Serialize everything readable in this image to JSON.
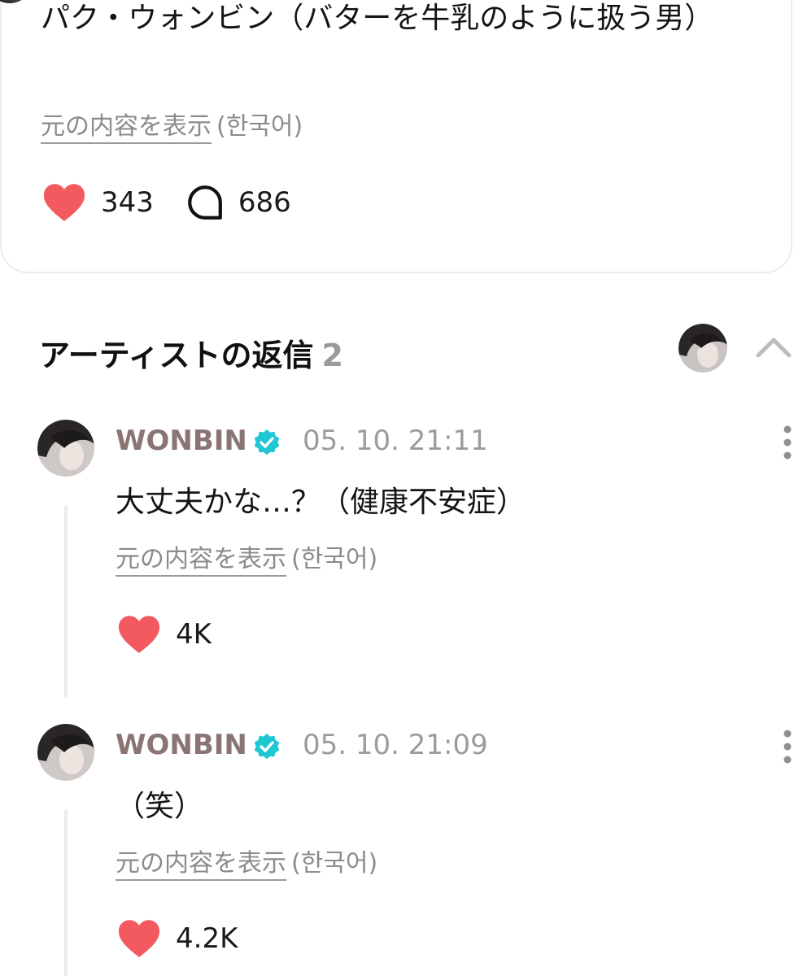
{
  "post": {
    "text": "パク・ウォンビン（バターを牛乳のように扱う男）",
    "translate_link": "元の内容を表示",
    "translate_lang": "(한국어)",
    "likes": "343",
    "comments": "686"
  },
  "artist_replies": {
    "title": "アーティストの返信",
    "count": "2"
  },
  "replies": [
    {
      "author": "WONBIN",
      "timestamp": "05. 10. 21:11",
      "text": "大丈夫かな…？（健康不安症）",
      "translate_link": "元の内容を表示",
      "translate_lang": "(한국어)",
      "likes": "4K"
    },
    {
      "author": "WONBIN",
      "timestamp": "05. 10. 21:09",
      "text": "（笑）",
      "translate_link": "元の内容を表示",
      "translate_lang": "(한국어)",
      "likes": "4.2K"
    }
  ],
  "colors": {
    "heart": "#f25a5f",
    "verified": "#1ec7d2",
    "author": "#8a7474",
    "muted": "#9b9b9b"
  },
  "icons": [
    "heart-icon",
    "comment-bubble-icon",
    "verified-badge-icon",
    "chevron-up-icon",
    "more-vertical-icon"
  ]
}
